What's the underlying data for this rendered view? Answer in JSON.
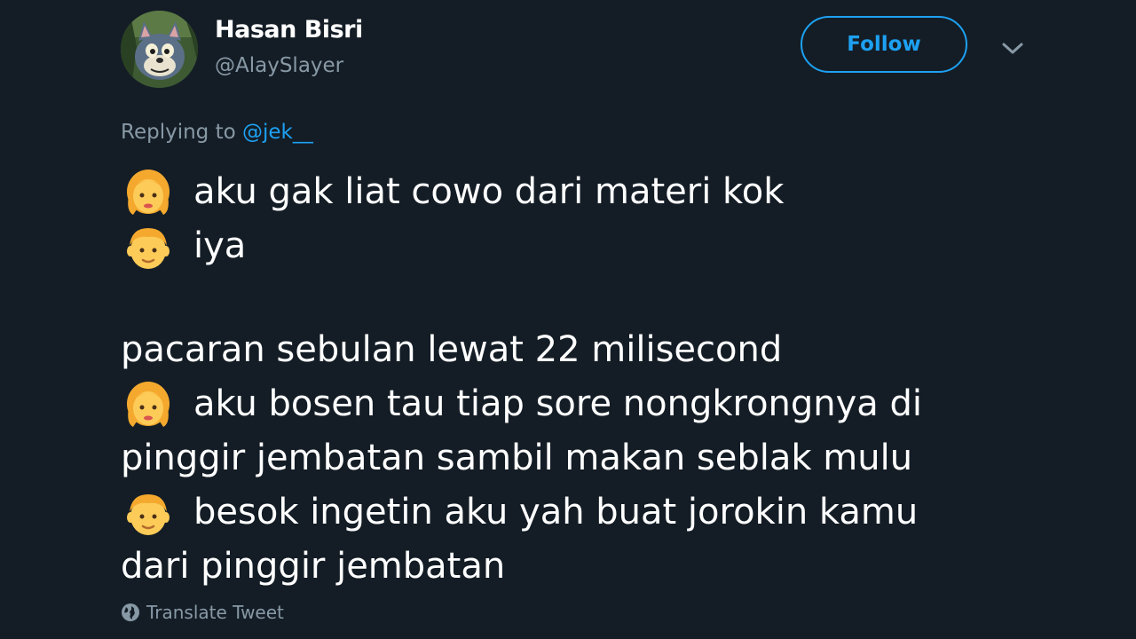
{
  "author": {
    "display_name": "Hasan Bisri",
    "handle": "@AlaySlayer",
    "avatar_icon": "cartoon-cat-avatar"
  },
  "follow_label": "Follow",
  "reply_context": {
    "prefix": "Replying to ",
    "mention": "@jek__"
  },
  "tweet_lines": [
    {
      "emoji": "woman-emoji",
      "text": "aku gak liat cowo dari materi kok"
    },
    {
      "emoji": "man-emoji",
      "text": "iya"
    },
    {
      "emoji": "",
      "text": ""
    },
    {
      "emoji": "",
      "text": "pacaran sebulan lewat 22 milisecond"
    },
    {
      "emoji": "woman-emoji",
      "text": "aku bosen tau tiap sore nongkrongnya di"
    },
    {
      "emoji": "",
      "text": "pinggir jembatan sambil makan seblak mulu"
    },
    {
      "emoji": "man-emoji",
      "text": "besok ingetin aku yah buat jorokin kamu"
    },
    {
      "emoji": "",
      "text": "dari pinggir jembatan"
    }
  ],
  "translate_label": "Translate Tweet",
  "colors": {
    "background": "#141d26",
    "accent": "#1da1f2",
    "muted": "#8899a6",
    "text": "#ffffff"
  }
}
